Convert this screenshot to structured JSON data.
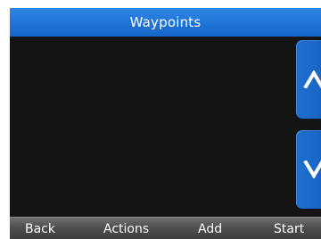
{
  "header": {
    "title": "Waypoints"
  },
  "list": {
    "items": []
  },
  "scroll": {
    "up_icon": "chevron-up-icon",
    "down_icon": "chevron-down-icon"
  },
  "softkeys": {
    "back": "Back",
    "actions": "Actions",
    "add": "Add",
    "start": "Start"
  },
  "colors": {
    "title_bar": "#1f73d6",
    "button_blue": "#1a67c6",
    "background": "#141414",
    "softkey_bar": "#4e4e4e",
    "text": "#ffffff"
  }
}
